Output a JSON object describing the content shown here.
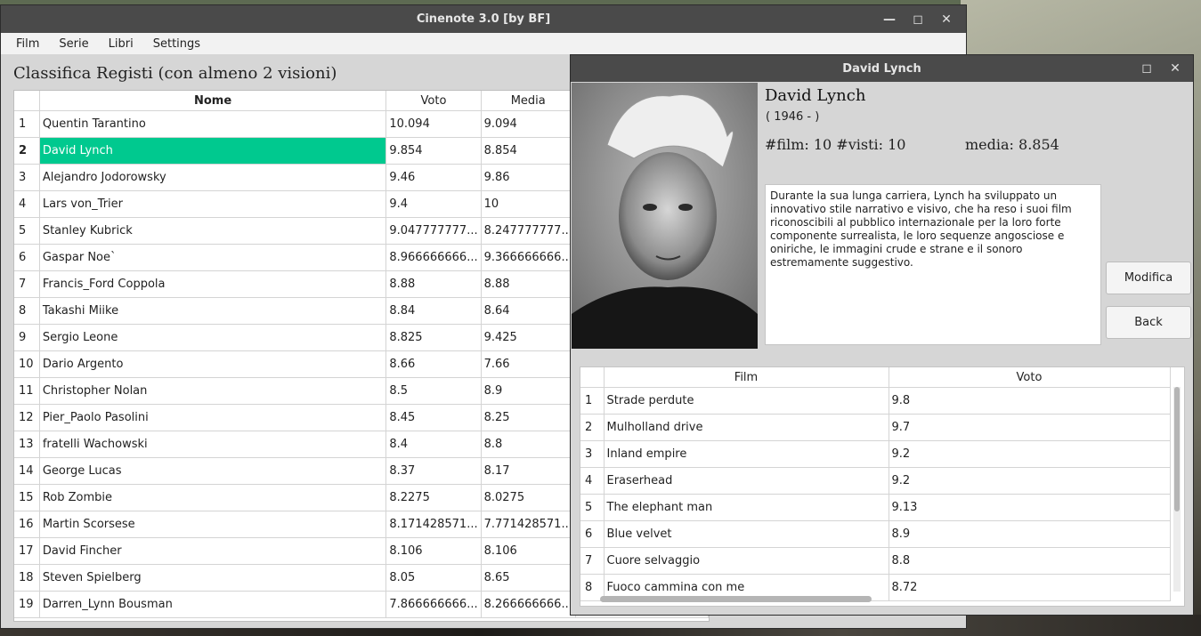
{
  "main_window": {
    "title": "Cinenote 3.0  [by BF]",
    "menu": [
      "Film",
      "Serie",
      "Libri",
      "Settings"
    ],
    "heading": "Classifica Registi (con almeno 2 visioni)",
    "columns": [
      "Nome",
      "Voto",
      "Media"
    ],
    "rows": [
      {
        "rank": "1",
        "name": "Quentin Tarantino",
        "voto": "10.094",
        "media": "9.094"
      },
      {
        "rank": "2",
        "name": "David Lynch",
        "voto": "9.854",
        "media": "8.854"
      },
      {
        "rank": "3",
        "name": "Alejandro Jodorowsky",
        "voto": "9.46",
        "media": "9.86"
      },
      {
        "rank": "4",
        "name": "Lars von_Trier",
        "voto": "9.4",
        "media": "10"
      },
      {
        "rank": "5",
        "name": "Stanley Kubrick",
        "voto": "9.047777777...",
        "media": "8.247777777..."
      },
      {
        "rank": "6",
        "name": "Gaspar Noe`",
        "voto": "8.966666666...",
        "media": "9.366666666..."
      },
      {
        "rank": "7",
        "name": "Francis_Ford Coppola",
        "voto": "8.88",
        "media": "8.88"
      },
      {
        "rank": "8",
        "name": "Takashi Miike",
        "voto": "8.84",
        "media": "8.64"
      },
      {
        "rank": "9",
        "name": "Sergio Leone",
        "voto": "8.825",
        "media": "9.425"
      },
      {
        "rank": "10",
        "name": "Dario Argento",
        "voto": "8.66",
        "media": "7.66"
      },
      {
        "rank": "11",
        "name": "Christopher Nolan",
        "voto": "8.5",
        "media": "8.9"
      },
      {
        "rank": "12",
        "name": "Pier_Paolo Pasolini",
        "voto": "8.45",
        "media": "8.25"
      },
      {
        "rank": "13",
        "name": "fratelli Wachowski",
        "voto": "8.4",
        "media": "8.8"
      },
      {
        "rank": "14",
        "name": "George Lucas",
        "voto": "8.37",
        "media": "8.17"
      },
      {
        "rank": "15",
        "name": "Rob Zombie",
        "voto": "8.2275",
        "media": "8.0275"
      },
      {
        "rank": "16",
        "name": "Martin Scorsese",
        "voto": "8.171428571...",
        "media": "7.771428571..."
      },
      {
        "rank": "17",
        "name": "David Fincher",
        "voto": "8.106",
        "media": "8.106"
      },
      {
        "rank": "18",
        "name": "Steven Spielberg",
        "voto": "8.05",
        "media": "8.65"
      },
      {
        "rank": "19",
        "name": "Darren_Lynn Bousman",
        "voto": "7.866666666...",
        "media": "8.266666666..."
      }
    ],
    "selected_rank": "2"
  },
  "detail_window": {
    "title": "David Lynch",
    "name": "David Lynch",
    "years": "( 1946 -  )",
    "stats": "#film: 10 #visti: 10",
    "media": "media: 8.854",
    "bio": "Durante la sua lunga carriera, Lynch ha sviluppato un innovativo stile narrativo e visivo, che ha reso i suoi film riconoscibili al pubblico internazionale per la loro forte componente surrealista, le loro sequenze angosciose e oniriche, le immagini crude e strane e il sonoro estremamente suggestivo.",
    "buttons": {
      "modifica": "Modifica",
      "back": "Back"
    },
    "film_columns": [
      "Film",
      "Voto"
    ],
    "films": [
      {
        "n": "1",
        "title": "Strade perdute",
        "voto": "9.8"
      },
      {
        "n": "2",
        "title": "Mulholland drive",
        "voto": "9.7"
      },
      {
        "n": "3",
        "title": "Inland empire",
        "voto": "9.2"
      },
      {
        "n": "4",
        "title": "Eraserhead",
        "voto": "9.2"
      },
      {
        "n": "5",
        "title": "The elephant man",
        "voto": "9.13"
      },
      {
        "n": "6",
        "title": "Blue velvet",
        "voto": "8.9"
      },
      {
        "n": "7",
        "title": "Cuore selvaggio",
        "voto": "8.8"
      },
      {
        "n": "8",
        "title": "Fuoco cammina con me",
        "voto": "8.72"
      }
    ]
  },
  "icons": {
    "minimize": "minimize-icon",
    "maximize": "maximize-icon",
    "close": "close-icon"
  }
}
